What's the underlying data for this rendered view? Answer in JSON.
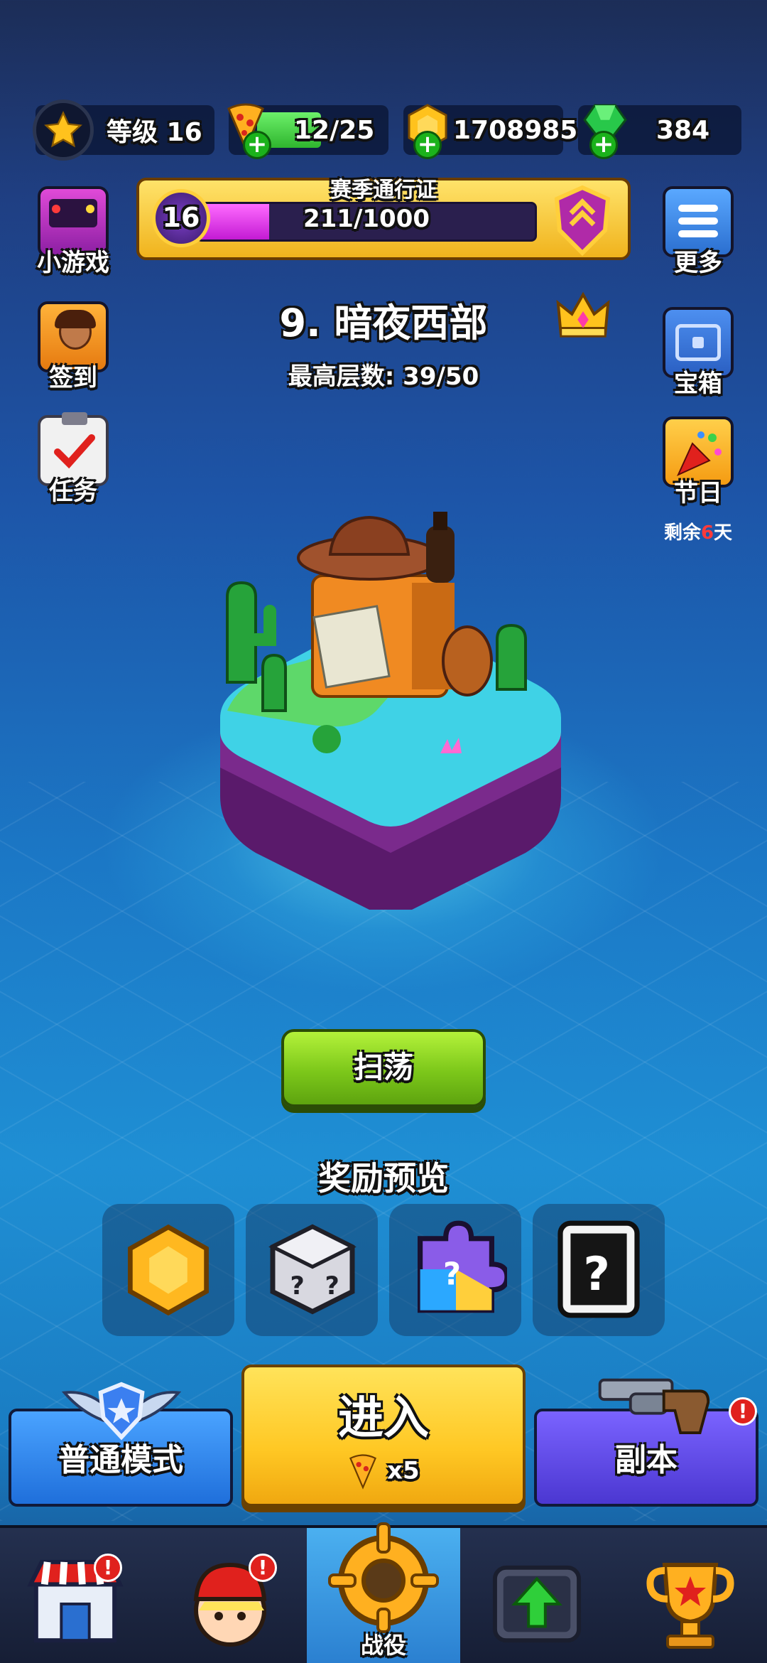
{
  "resources": {
    "level_label": "等级 16",
    "pizza": "12/25",
    "gold": "1708985",
    "gems": "384"
  },
  "season_pass": {
    "title": "赛季通行证",
    "level": "16",
    "progress_text": "211/1000",
    "progress_fraction": 0.211
  },
  "left_menu": {
    "minigame": "小游戏",
    "checkin": "签到",
    "tasks": "任务"
  },
  "right_menu": {
    "more": "更多",
    "chest": "宝箱",
    "festival": "节日",
    "festival_remaining_prefix": "剩余",
    "festival_remaining_days": "6",
    "festival_remaining_suffix": "天"
  },
  "stage": {
    "title": "9. 暗夜西部",
    "best_floor": "最高层数: 39/50"
  },
  "sweep_label": "扫荡",
  "rewards": {
    "title": "奖励预览",
    "items": [
      "gold-coin-icon",
      "mystery-dice-icon",
      "mystery-puzzle-icon",
      "mystery-card-icon"
    ]
  },
  "modes": {
    "normal": "普通模式",
    "enter": "进入",
    "enter_cost": "x5",
    "dungeon": "副本",
    "alert_mark": "!"
  },
  "nav": {
    "campaign": "战役",
    "active": "campaign"
  },
  "colors": {
    "accent_green": "#7cc71a",
    "accent_yellow": "#ffc824",
    "alert_red": "#e0211d",
    "pass_fill": "#c31bd3"
  }
}
